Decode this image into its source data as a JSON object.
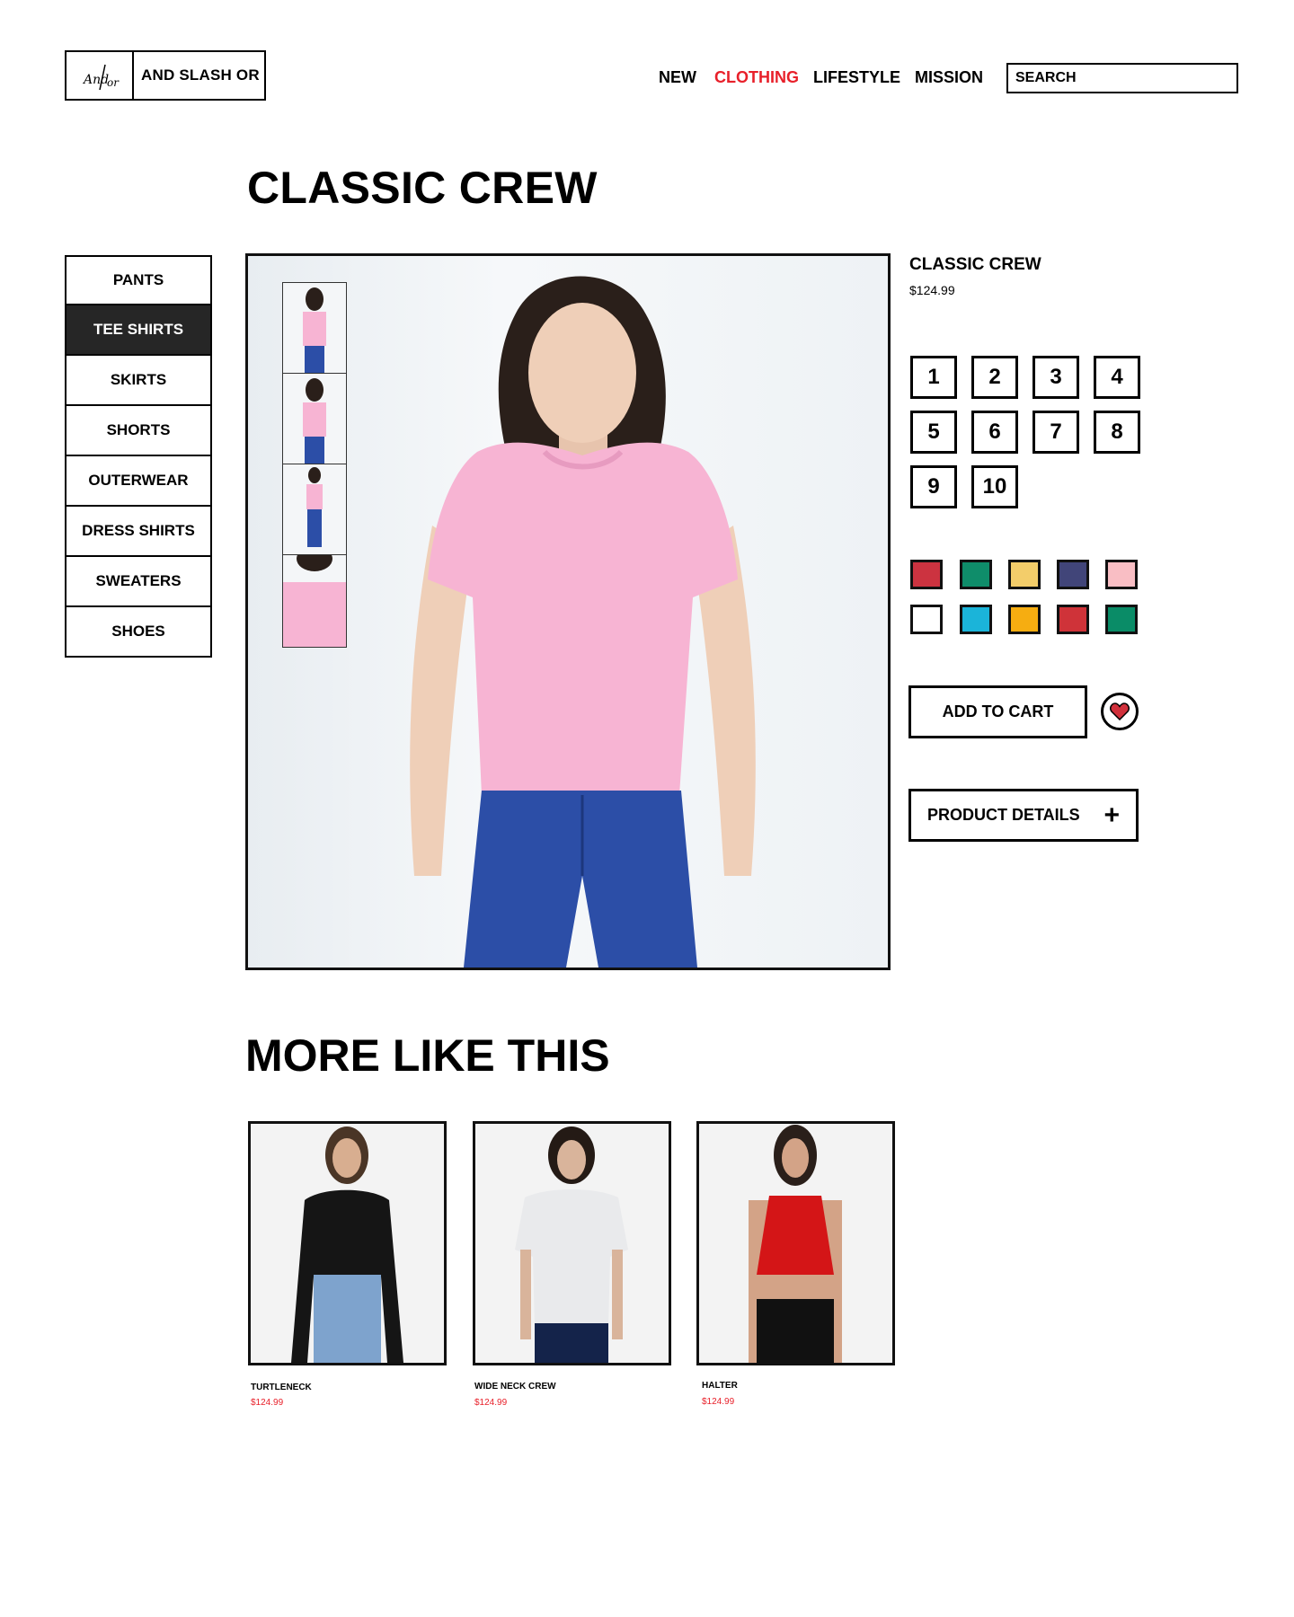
{
  "header": {
    "logo_text": "AND SLASH OR",
    "logo_mark": "And/or",
    "nav": [
      {
        "label": "NEW",
        "active": false
      },
      {
        "label": "CLOTHING",
        "active": true
      },
      {
        "label": "LIFESTYLE",
        "active": false
      },
      {
        "label": "MISSION",
        "active": false
      }
    ],
    "search_placeholder": "SEARCH"
  },
  "page_title": "CLASSIC CREW",
  "sidebar": {
    "items": [
      {
        "label": "PANTS",
        "active": false
      },
      {
        "label": "TEE SHIRTS",
        "active": true
      },
      {
        "label": "SKIRTS",
        "active": false
      },
      {
        "label": "SHORTS",
        "active": false
      },
      {
        "label": "OUTERWEAR",
        "active": false
      },
      {
        "label": "DRESS SHIRTS",
        "active": false
      },
      {
        "label": "SWEATERS",
        "active": false
      },
      {
        "label": "SHOES",
        "active": false
      }
    ]
  },
  "product": {
    "name": "CLASSIC CREW",
    "price": "$124.99",
    "sizes": [
      "1",
      "2",
      "3",
      "4",
      "5",
      "6",
      "7",
      "8",
      "9",
      "10"
    ],
    "colors": [
      "#cc3340",
      "#0f8d6a",
      "#f3cd6a",
      "#414579",
      "#f9bec4",
      "#ffffff",
      "#1bb4d9",
      "#f6ad11",
      "#cf3339",
      "#0a8c67"
    ],
    "add_to_cart": "ADD TO CART",
    "details_label": "PRODUCT DETAILS",
    "accent": "#e8202a",
    "shirt_color": "#f7b4d3",
    "jeans_color": "#2c4ea7"
  },
  "more": {
    "title": "MORE LIKE THIS",
    "items": [
      {
        "name": "TURTLENECK",
        "price": "$124.99",
        "top_color": "#151515",
        "bottom_color": "#7ea3cd"
      },
      {
        "name": "WIDE NECK CREW",
        "price": "$124.99",
        "top_color": "#e9eaec",
        "bottom_color": "#14234a"
      },
      {
        "name": "HALTER",
        "price": "$124.99",
        "top_color": "#d41517",
        "bottom_color": "#111111"
      }
    ]
  }
}
